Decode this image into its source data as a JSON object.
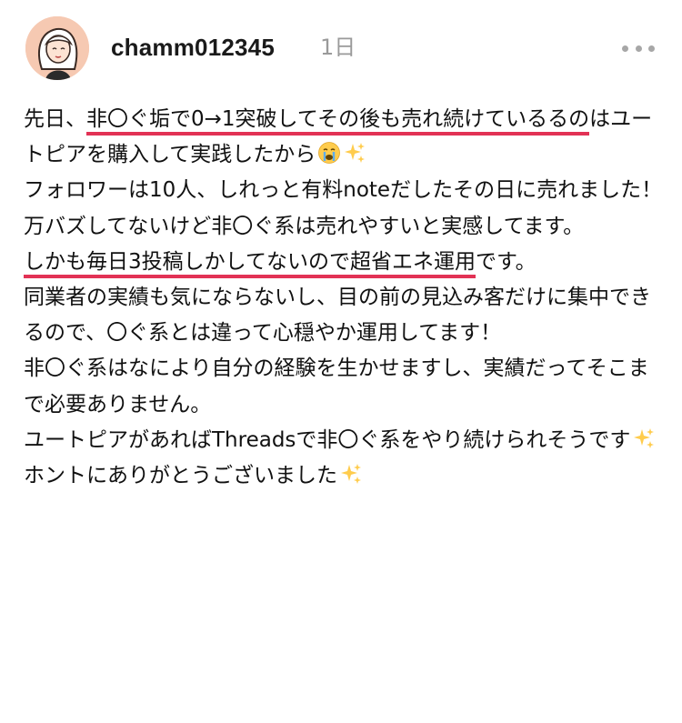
{
  "post": {
    "username": "chamm012345",
    "time": "1日",
    "body": {
      "line1_prefix": "先日、",
      "line1_highlight": "非〇ぐ垢で0→1突破してその後も売れ続けている",
      "line1_highlight_tail": "るの",
      "line1_rest": "はユートピアを購入して実践したから",
      "p2": "フォロワーは10人、しれっと有料noteだしたその日に売れました！",
      "p3": "万バズしてないけど非〇ぐ系は売れやすいと実感してます。",
      "p4_highlight": "しかも毎日3投稿しかしてないので超省エネ運用",
      "p4_rest": "です。",
      "p5": "同業者の実績も気にならないし、目の前の見込み客だけに集中できるので、〇ぐ系とは違って心穏やか運用してます！",
      "p6": "非〇ぐ系はなにより自分の経験を生かせますし、実績だってそこまで必要ありません。",
      "p7": "ユートピアがあればThreadsで非〇ぐ系をやり続けられそうです",
      "p8": "ホントにありがとうございました"
    }
  },
  "icons": {
    "more": "more-horizontal-icon",
    "emoji_cry": "crying-face-emoji",
    "emoji_sparkles": "sparkles-emoji"
  },
  "colors": {
    "highlight_underline": "#e23255",
    "avatar_bg": "#f6c9b2",
    "time": "#9a9a9a"
  }
}
